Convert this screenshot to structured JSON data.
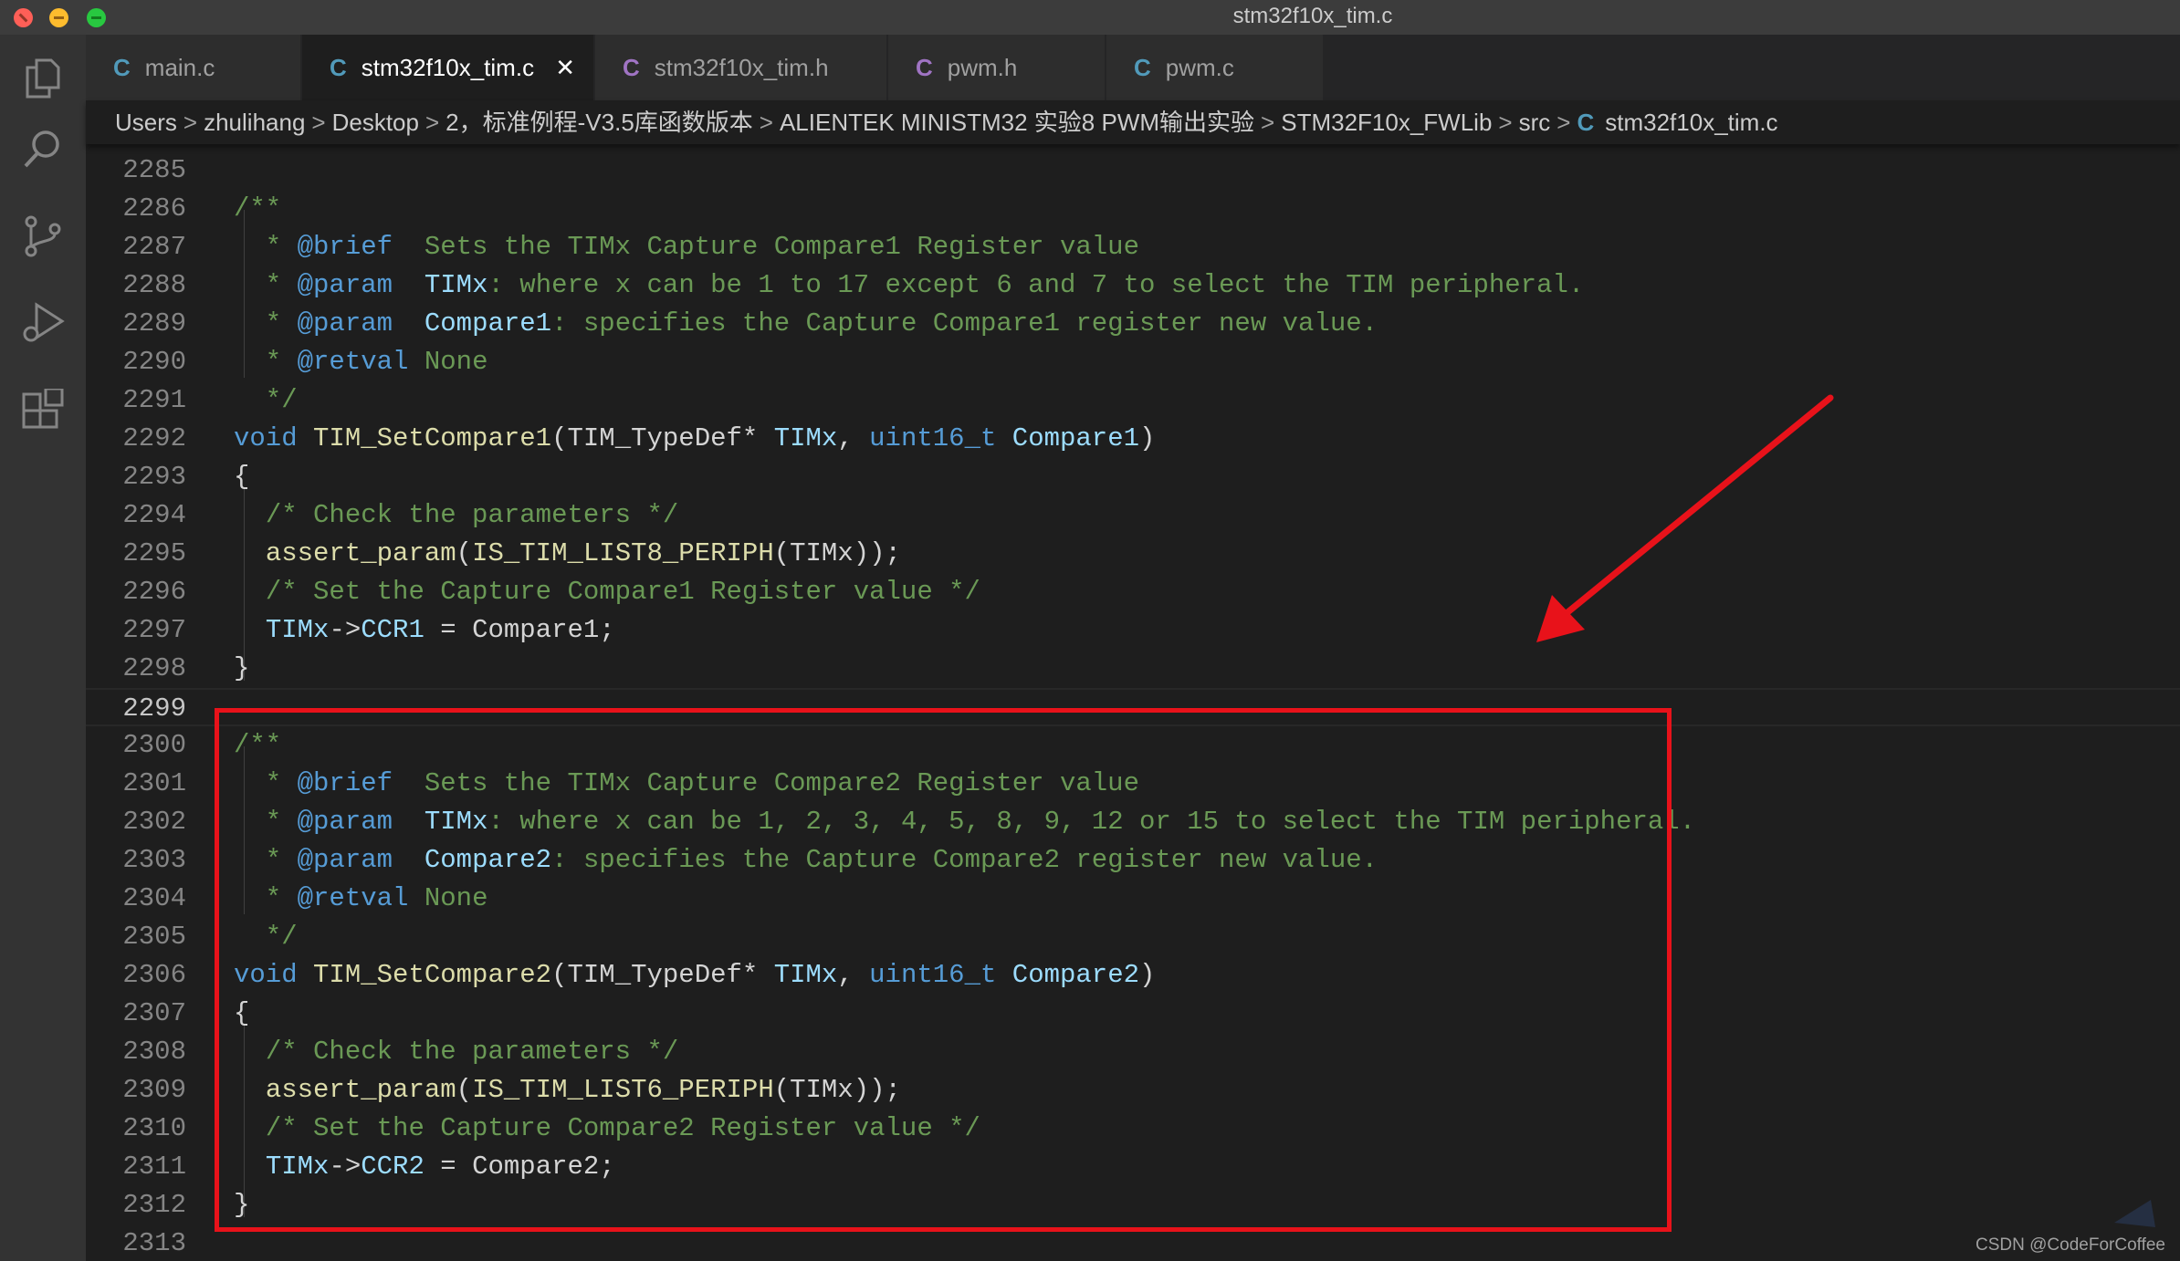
{
  "window": {
    "title": "stm32f10x_tim.c"
  },
  "activity_bar": {
    "icons": [
      "files-icon",
      "search-icon",
      "source-control-icon",
      "run-debug-icon",
      "extensions-icon"
    ]
  },
  "tabs": [
    {
      "icon": "C",
      "label": "main.c",
      "active": false
    },
    {
      "icon": "C",
      "label": "stm32f10x_tim.c",
      "active": true,
      "close": "✕"
    },
    {
      "icon": "C",
      "label": "stm32f10x_tim.h",
      "active": false
    },
    {
      "icon": "C",
      "label": "pwm.h",
      "active": false
    },
    {
      "icon": "C",
      "label": "pwm.c",
      "active": false
    }
  ],
  "breadcrumb": {
    "items": [
      "Users",
      "zhulihang",
      "Desktop",
      "2，标准例程-V3.5库函数版本",
      "ALIENTEK MINISTM32 实验8 PWM输出实验",
      "STM32F10x_FWLib",
      "src"
    ],
    "file_icon": "C",
    "file": "stm32f10x_tim.c",
    "separator": ">"
  },
  "editor": {
    "current_line": "2299",
    "lines": [
      {
        "n": "2285",
        "t": []
      },
      {
        "n": "2286",
        "t": [
          [
            "cm",
            "/**"
          ]
        ]
      },
      {
        "n": "2287",
        "t": [
          [
            "cm",
            "  * "
          ],
          [
            "tag",
            "@brief"
          ],
          [
            "cm",
            "  Sets the TIMx Capture Compare1 Register value"
          ]
        ]
      },
      {
        "n": "2288",
        "t": [
          [
            "cm",
            "  * "
          ],
          [
            "tag",
            "@param"
          ],
          [
            "cm",
            "  "
          ],
          [
            "cmv",
            "TIMx"
          ],
          [
            "cm",
            ": where x can be 1 to 17 except 6 and 7 to select the TIM peripheral."
          ]
        ]
      },
      {
        "n": "2289",
        "t": [
          [
            "cm",
            "  * "
          ],
          [
            "tag",
            "@param"
          ],
          [
            "cm",
            "  "
          ],
          [
            "cmv",
            "Compare1"
          ],
          [
            "cm",
            ": specifies the Capture Compare1 register new value."
          ]
        ]
      },
      {
        "n": "2290",
        "t": [
          [
            "cm",
            "  * "
          ],
          [
            "tag",
            "@retval"
          ],
          [
            "cm",
            " None"
          ]
        ]
      },
      {
        "n": "2291",
        "t": [
          [
            "cm",
            "  */"
          ]
        ]
      },
      {
        "n": "2292",
        "t": [
          [
            "kw",
            "void"
          ],
          [
            "pl",
            " "
          ],
          [
            "fn",
            "TIM_SetCompare1"
          ],
          [
            "pl",
            "(TIM_TypeDef* "
          ],
          [
            "var",
            "TIMx"
          ],
          [
            "pl",
            ", "
          ],
          [
            "kw",
            "uint16_t"
          ],
          [
            "pl",
            " "
          ],
          [
            "var",
            "Compare1"
          ],
          [
            "pl",
            ")"
          ]
        ]
      },
      {
        "n": "2293",
        "t": [
          [
            "pl",
            "{"
          ]
        ]
      },
      {
        "n": "2294",
        "t": [
          [
            "pl",
            "  "
          ],
          [
            "cm",
            "/* Check the parameters */"
          ]
        ]
      },
      {
        "n": "2295",
        "t": [
          [
            "pl",
            "  "
          ],
          [
            "fn",
            "assert_param"
          ],
          [
            "pl",
            "("
          ],
          [
            "fn",
            "IS_TIM_LIST8_PERIPH"
          ],
          [
            "pl",
            "(TIMx));"
          ]
        ]
      },
      {
        "n": "2296",
        "t": [
          [
            "pl",
            "  "
          ],
          [
            "cm",
            "/* Set the Capture Compare1 Register value */"
          ]
        ]
      },
      {
        "n": "2297",
        "t": [
          [
            "pl",
            "  "
          ],
          [
            "var",
            "TIMx"
          ],
          [
            "pl",
            "->"
          ],
          [
            "var",
            "CCR1"
          ],
          [
            "pl",
            " = Compare1;"
          ]
        ]
      },
      {
        "n": "2298",
        "t": [
          [
            "pl",
            "}"
          ]
        ]
      },
      {
        "n": "2299",
        "t": []
      },
      {
        "n": "2300",
        "t": [
          [
            "cm",
            "/**"
          ]
        ]
      },
      {
        "n": "2301",
        "t": [
          [
            "cm",
            "  * "
          ],
          [
            "tag",
            "@brief"
          ],
          [
            "cm",
            "  Sets the TIMx Capture Compare2 Register value"
          ]
        ]
      },
      {
        "n": "2302",
        "t": [
          [
            "cm",
            "  * "
          ],
          [
            "tag",
            "@param"
          ],
          [
            "cm",
            "  "
          ],
          [
            "cmv",
            "TIMx"
          ],
          [
            "cm",
            ": where x can be 1, 2, 3, 4, 5, 8, 9, 12 or 15 to select the TIM peripheral."
          ]
        ]
      },
      {
        "n": "2303",
        "t": [
          [
            "cm",
            "  * "
          ],
          [
            "tag",
            "@param"
          ],
          [
            "cm",
            "  "
          ],
          [
            "cmv",
            "Compare2"
          ],
          [
            "cm",
            ": specifies the Capture Compare2 register new value."
          ]
        ]
      },
      {
        "n": "2304",
        "t": [
          [
            "cm",
            "  * "
          ],
          [
            "tag",
            "@retval"
          ],
          [
            "cm",
            " None"
          ]
        ]
      },
      {
        "n": "2305",
        "t": [
          [
            "cm",
            "  */"
          ]
        ]
      },
      {
        "n": "2306",
        "t": [
          [
            "kw",
            "void"
          ],
          [
            "pl",
            " "
          ],
          [
            "fn",
            "TIM_SetCompare2"
          ],
          [
            "pl",
            "(TIM_TypeDef* "
          ],
          [
            "var",
            "TIMx"
          ],
          [
            "pl",
            ", "
          ],
          [
            "kw",
            "uint16_t"
          ],
          [
            "pl",
            " "
          ],
          [
            "var",
            "Compare2"
          ],
          [
            "pl",
            ")"
          ]
        ]
      },
      {
        "n": "2307",
        "t": [
          [
            "pl",
            "{"
          ]
        ]
      },
      {
        "n": "2308",
        "t": [
          [
            "pl",
            "  "
          ],
          [
            "cm",
            "/* Check the parameters */"
          ]
        ]
      },
      {
        "n": "2309",
        "t": [
          [
            "pl",
            "  "
          ],
          [
            "fn",
            "assert_param"
          ],
          [
            "pl",
            "("
          ],
          [
            "fn",
            "IS_TIM_LIST6_PERIPH"
          ],
          [
            "pl",
            "(TIMx));"
          ]
        ]
      },
      {
        "n": "2310",
        "t": [
          [
            "pl",
            "  "
          ],
          [
            "cm",
            "/* Set the Capture Compare2 Register value */"
          ]
        ]
      },
      {
        "n": "2311",
        "t": [
          [
            "pl",
            "  "
          ],
          [
            "var",
            "TIMx"
          ],
          [
            "pl",
            "->"
          ],
          [
            "var",
            "CCR2"
          ],
          [
            "pl",
            " = Compare2;"
          ]
        ]
      },
      {
        "n": "2312",
        "t": [
          [
            "pl",
            "}"
          ]
        ]
      },
      {
        "n": "2313",
        "t": []
      }
    ]
  },
  "annotations": {
    "box_color": "#e8121a",
    "arrow_color": "#e8121a"
  },
  "watermark": "CSDN @CodeForCoffee"
}
